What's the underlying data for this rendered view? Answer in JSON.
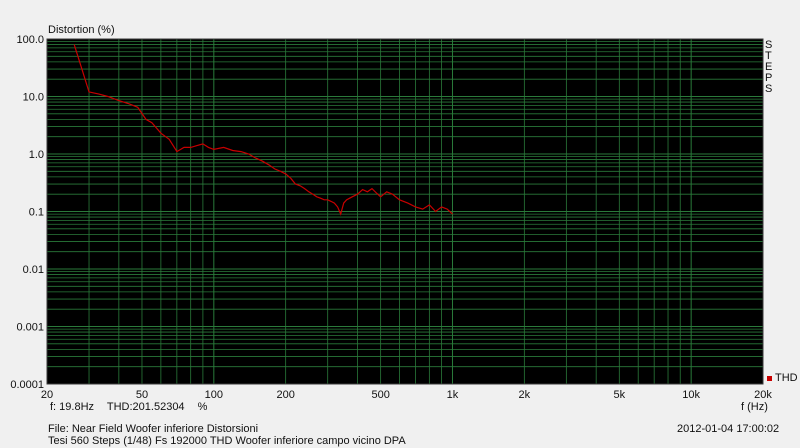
{
  "chart_data": {
    "type": "line",
    "title": "Distortion (%)",
    "xlabel": "f (Hz)",
    "ylabel": "Distortion (%)",
    "x_scale": "log",
    "y_scale": "log",
    "xlim": [
      20,
      20000
    ],
    "ylim": [
      0.0001,
      100
    ],
    "x_ticks": [
      20,
      50,
      100,
      200,
      500,
      1000,
      2000,
      5000,
      10000,
      20000
    ],
    "x_tick_labels": [
      "20",
      "50",
      "100",
      "200",
      "500",
      "1k",
      "2k",
      "5k",
      "10k",
      "20k"
    ],
    "y_ticks": [
      100,
      10,
      1,
      0.1,
      0.01,
      0.001,
      0.0001
    ],
    "y_tick_labels": [
      "100.0",
      "10.0",
      "1.0",
      "0.1",
      "0.01",
      "0.001",
      "0.0001"
    ],
    "grid": true,
    "legend": "right",
    "series": [
      {
        "name": "THD",
        "color": "#c80000",
        "x": [
          26,
          28,
          30,
          33,
          36,
          40,
          44,
          48,
          52,
          55,
          60,
          65,
          70,
          75,
          80,
          85,
          90,
          95,
          100,
          110,
          120,
          130,
          140,
          150,
          160,
          170,
          180,
          190,
          200,
          210,
          220,
          230,
          240,
          250,
          260,
          270,
          280,
          290,
          300,
          310,
          320,
          330,
          340,
          350,
          360,
          380,
          400,
          420,
          440,
          460,
          480,
          500,
          530,
          560,
          600,
          650,
          700,
          750,
          800,
          850,
          900,
          950,
          1000
        ],
        "y": [
          80,
          30,
          12,
          11,
          10,
          8.5,
          7.5,
          6.5,
          4,
          3.5,
          2.3,
          1.8,
          1.1,
          1.3,
          1.3,
          1.4,
          1.5,
          1.3,
          1.2,
          1.3,
          1.15,
          1.1,
          1.0,
          0.85,
          0.75,
          0.65,
          0.55,
          0.5,
          0.45,
          0.38,
          0.3,
          0.28,
          0.25,
          0.22,
          0.2,
          0.18,
          0.17,
          0.16,
          0.16,
          0.15,
          0.14,
          0.12,
          0.09,
          0.14,
          0.16,
          0.18,
          0.2,
          0.24,
          0.22,
          0.25,
          0.21,
          0.18,
          0.22,
          0.2,
          0.16,
          0.14,
          0.12,
          0.11,
          0.13,
          0.1,
          0.12,
          0.11,
          0.09
        ]
      }
    ]
  },
  "steps_label": "STEPS",
  "cursor": {
    "freq": "f: 19.8Hz",
    "thd": "THD:201.52304",
    "unit": "%"
  },
  "footer": {
    "file": "File: Near Field Woofer inferiore Distorsioni",
    "info": "Tesi 560  Steps (1/48) Fs 192000 THD Woofer inferiore campo vicino     DPA",
    "timestamp": "2012-01-04 17:00:02"
  },
  "colors": {
    "plot_bg": "#000000",
    "grid": "#2a7a3a",
    "trace": "#c80000"
  }
}
